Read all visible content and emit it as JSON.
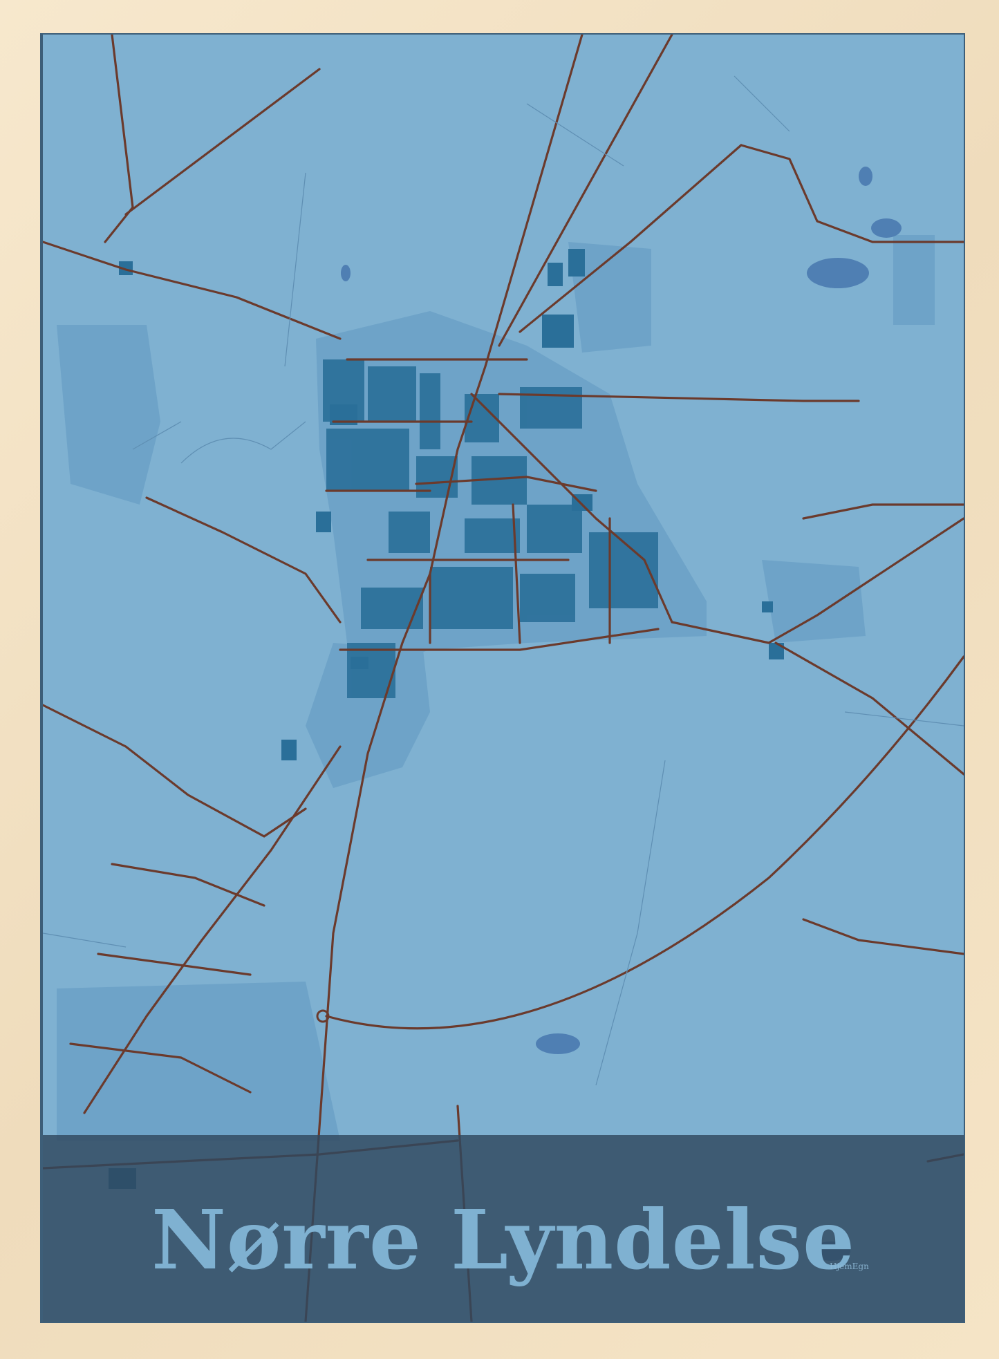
{
  "poster": {
    "title": "Nørre Lyndelse",
    "brand": "HjemEgn"
  },
  "colors": {
    "frame": "#f3e3c8",
    "land": "#7fb1d1",
    "area": "#6ea3c8",
    "building": "#2a6f99",
    "water": "#4f7fb3",
    "road": "#6b3a2c",
    "title_band": "#30485e",
    "title_text": "#7fb1d1"
  }
}
